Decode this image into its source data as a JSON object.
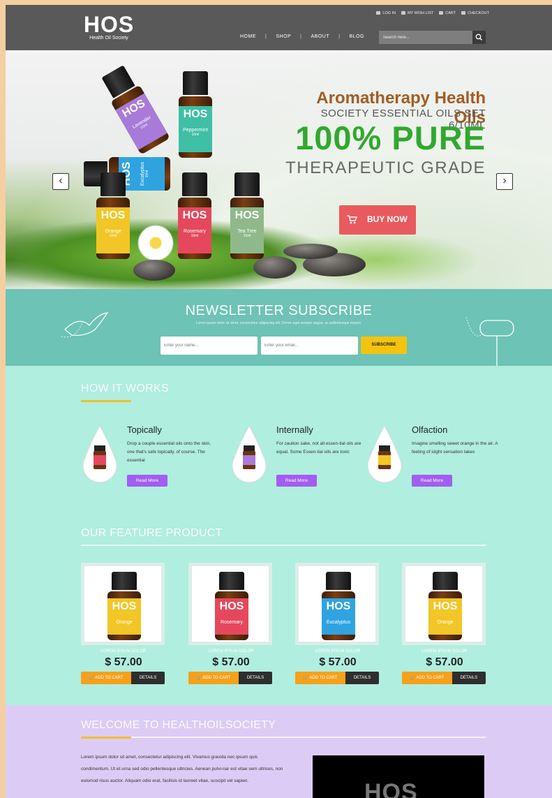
{
  "brand": {
    "logo_mark": "HOS",
    "logo_sub": "Health Oil Society"
  },
  "top_links": [
    {
      "label": "LOG IN",
      "icon": "user-icon"
    },
    {
      "label": "MY WISH LIST",
      "icon": "heart-icon"
    },
    {
      "label": "CART",
      "icon": "cart-icon"
    },
    {
      "label": "CHECKOUT",
      "icon": "checkout-icon"
    }
  ],
  "nav": {
    "home": "HOME",
    "shop": "SHOP",
    "about": "ABOUT",
    "blog": "BLOG",
    "separator": "|"
  },
  "search": {
    "placeholder": "Search here..."
  },
  "hero": {
    "line1": "Aromatherapy Health Oils",
    "line2": "SOCIETY ESSENTIAL OILS SET 6/10ML",
    "line3": "100% PURE",
    "line4": "THERAPEUTIC GRADE",
    "buy_label": "BUY NOW",
    "prev_arrow": "‹",
    "next_arrow": "›",
    "bottles": [
      {
        "name": "Lavender",
        "size": "10ml",
        "color": "#a97bd8"
      },
      {
        "name": "Peppermint",
        "size": "10ml",
        "color": "#3fbfa6"
      },
      {
        "name": "Eucalyptus",
        "size": "10ml",
        "color": "#2fa3e0"
      },
      {
        "name": "Orange",
        "size": "10ml",
        "color": "#f1c626"
      },
      {
        "name": "Rosemary",
        "size": "10ml",
        "color": "#e5485c"
      },
      {
        "name": "Tea Tree",
        "size": "10ml",
        "color": "#8fb98a"
      }
    ]
  },
  "newsletter": {
    "title": "NEWSLETTER SUBSCRIBE",
    "subtitle": "Lorem ipsum dolor sit amet, consectetur adipiscing elit. Donec eget semper augue, ac pellentesque mauris.",
    "name_placeholder": "Enter your name...",
    "email_placeholder": "Enter your email...",
    "button": "SUBSCRIBE"
  },
  "how": {
    "title": "HOW IT WORKS",
    "items": [
      {
        "title": "Topically",
        "text": "Drop a couple essential oils onto the skin, one that's safe topically, of course. The essential",
        "button": "Read More",
        "color": "#e5485c"
      },
      {
        "title": "Internally",
        "text": "For caution sake, not all essen-tial oils are equal. Some Essen-tial oils are toxic",
        "button": "Read More",
        "color": "#a97bd8"
      },
      {
        "title": "Olfaction",
        "text": "Imagine smelling sweet orange in the air. A feeling of slight sensation takes",
        "button": "Read More",
        "color": "#f1c626"
      }
    ]
  },
  "featured": {
    "title": "OUR FEATURE PRODUCT",
    "add_label": "ADD TO CART",
    "details_label": "DETAILS",
    "products": [
      {
        "name": "LOREM IPSUM DOLOR",
        "price": "$ 57.00",
        "label": "Orange",
        "color": "#f1c626"
      },
      {
        "name": "LOREM IPSUM DOLOR",
        "price": "$ 57.00",
        "label": "Rosemary",
        "color": "#e5485c"
      },
      {
        "name": "LOREM IPSUM DOLOR",
        "price": "$ 57.00",
        "label": "Eucalyptus",
        "color": "#2fa3e0"
      },
      {
        "name": "LOREM IPSUM DOLOR",
        "price": "$ 57.00",
        "label": "Orange",
        "color": "#f1c626"
      }
    ]
  },
  "welcome": {
    "title": "WELCOME TO HEALTHOILSOCIETY",
    "text": "Lorem ipsum dolor sit amet, consectetur adipiscing elit. Vivamus gravida nec ipsum quis condimentum. Ut et urna sed odio pellentesque ultricies. Aenean pulvi-nar est vitae sem ultrices, non euismod risus auctor. Aliquam odio erat, facilisis id laoreet vitae, suscipit vel sapien.",
    "video_logo": "HOS"
  },
  "colors": {
    "header": "#595959",
    "accent_yellow": "#f0c02c",
    "newsletter_bg": "#6dc3b5",
    "mint_bg": "#b0eedf",
    "lavender_bg": "#dcccf5",
    "buy_red": "#e85a5e",
    "pure_green": "#31a82e",
    "read_more_purple": "#a35df0"
  }
}
